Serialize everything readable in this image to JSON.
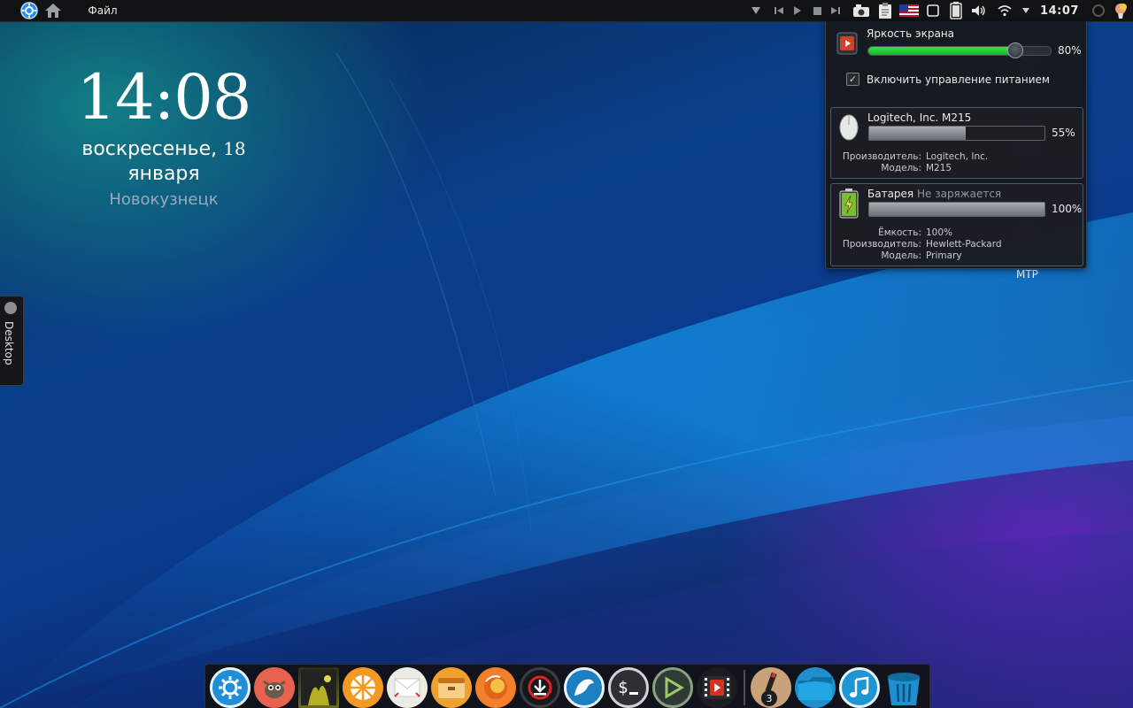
{
  "top_panel": {
    "menu_file": "Файл",
    "clock": "14:07",
    "icons": [
      "kde-menu-icon",
      "home-icon",
      "media-triangle-icon",
      "media-prev-icon",
      "media-play-icon",
      "media-stop-icon",
      "media-next-icon",
      "camera-icon",
      "clipboard-icon",
      "us-flag-icon",
      "window-square-icon",
      "battery-icon",
      "volume-icon",
      "wifi-icon",
      "chevron-down-icon",
      "search-icon",
      "notification-balloon-icon"
    ]
  },
  "clock_widget": {
    "time": "14:08",
    "weekday": "воскресенье,",
    "day": "18",
    "month": "января",
    "city": "Новокузнецк"
  },
  "desktop_tab": {
    "label": "Desktop"
  },
  "power_popup": {
    "brightness": {
      "label": "Яркость экрана",
      "value_text": "80%",
      "value": 0.8
    },
    "power_management": {
      "label": "Включить управление питанием",
      "checked": true
    },
    "mouse": {
      "title": "Logitech, Inc. M215",
      "value_text": "55%",
      "value": 0.55,
      "details": [
        {
          "key": "Производитель:",
          "value": "Logitech, Inc."
        },
        {
          "key": "Модель:",
          "value": "M215"
        }
      ]
    },
    "battery": {
      "title": "Батарея",
      "status": "Не заряжается",
      "value_text": "100%",
      "value": 1.0,
      "details": [
        {
          "key": "Ёмкость:",
          "value": "100%"
        },
        {
          "key": "Производитель:",
          "value": "Hewlett-Packard"
        },
        {
          "key": "Модель:",
          "value": "Primary"
        }
      ]
    }
  },
  "desktop_label_mtp": "MTP",
  "dock": {
    "badge_count": "3",
    "apps": [
      "kde-launcher-icon",
      "gimp-icon",
      "photo-viewer-icon",
      "disk-usage-icon",
      "mail-icon",
      "archive-manager-icon",
      "firefox-icon",
      "download-manager-icon",
      "dolphin-icon",
      "terminal-icon",
      "media-player-icon",
      "video-editor-icon",
      "text-editor-icon",
      "folder-icon",
      "music-icon",
      "trash-icon"
    ]
  },
  "colors": {
    "accent_green": "#2ecc40",
    "panel_bg": "#111214",
    "dock_blue": "#1f9ad6"
  }
}
